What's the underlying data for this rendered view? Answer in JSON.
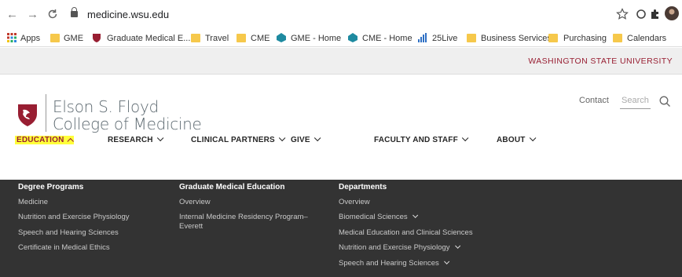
{
  "browser": {
    "url": "medicine.wsu.edu",
    "bookmarks": [
      "Apps",
      "GME",
      "Graduate Medical E...",
      "Travel",
      "CME",
      "GME - Home",
      "CME - Home",
      "25Live",
      "Business Services",
      "Purchasing",
      "Calendars"
    ]
  },
  "site": {
    "top_banner": "WASHINGTON STATE UNIVERSITY",
    "logo_line1": "Elson S. Floyd",
    "logo_line2": "College of Medicine",
    "contact": "Contact",
    "search_placeholder": "Search"
  },
  "nav": [
    "EDUCATION",
    "RESEARCH",
    "CLINICAL PARTNERS",
    "GIVE",
    "FACULTY AND STAFF",
    "ABOUT"
  ],
  "mega_menu": {
    "col1": {
      "title": "Degree Programs",
      "links": [
        "Medicine",
        "Nutrition and Exercise Physiology",
        "Speech and Hearing Sciences",
        "Certificate in Medical Ethics"
      ]
    },
    "col2": {
      "title": "Graduate Medical Education",
      "links": [
        "Overview",
        "Internal Medicine Residency Program–Everett"
      ]
    },
    "col3": {
      "title": "Departments",
      "links": [
        "Overview",
        "Biomedical Sciences",
        "Medical Education and Clinical Sciences",
        "Nutrition and Exercise Physiology",
        "Speech and Hearing Sciences"
      ]
    }
  },
  "colors": {
    "crimson": "#981e32",
    "menu_bg": "#333333",
    "highlight": "#ffff3a"
  }
}
